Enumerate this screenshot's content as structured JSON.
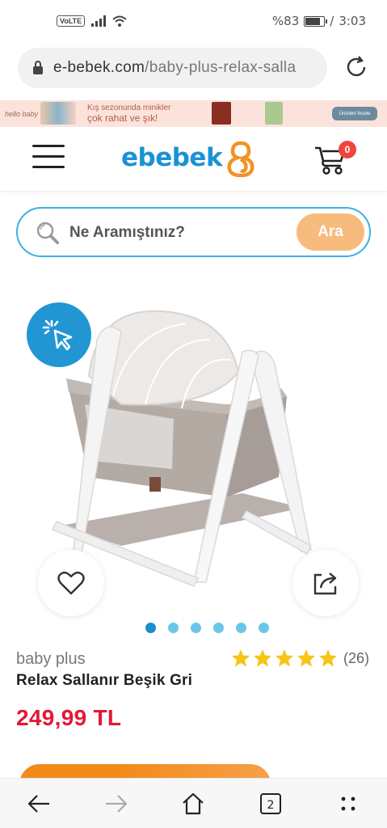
{
  "status_bar": {
    "network": "VoLTE",
    "battery_text": "%83",
    "battery_level": 0.83,
    "time": "3:03",
    "separator": "/"
  },
  "browser": {
    "url_domain": "e-bebek.com",
    "url_path": "/baby-plus-relax-salla",
    "tab_count": "2"
  },
  "promo": {
    "brand": "hello baby",
    "line1": "Kış sezonunda minikler",
    "line2": "çok rahat ve şık!",
    "button": "Ürünleri İncele"
  },
  "header": {
    "logo": "ebebek",
    "cart_count": "0"
  },
  "search": {
    "placeholder": "Ne Aramıştınız?",
    "button": "Ara"
  },
  "product": {
    "brand": "baby plus",
    "title": "Relax Sallanır Beşik Gri",
    "rating_stars": 5,
    "review_count": "(26)",
    "price": "249,99 TL",
    "image_count": 6,
    "active_image": 0
  },
  "colors": {
    "brand_blue": "#1a92d3",
    "search_border": "#3bb0e6",
    "search_button": "#f7bb7d",
    "price_red": "#e31837",
    "star_yellow": "#f5c518",
    "cta_orange": "#f28b1a",
    "cart_badge": "#f0443d"
  },
  "icons": {
    "lock": "lock-icon",
    "reload": "reload-icon",
    "menu": "hamburger-icon",
    "cart": "stroller-cart-icon",
    "search": "magnifier-icon",
    "zoom": "tap-cursor-icon",
    "favorite": "heart-icon",
    "share": "share-icon",
    "back": "arrow-left-icon",
    "forward": "arrow-right-icon",
    "home": "home-icon",
    "tabs": "tabs-icon",
    "more": "more-dots-icon"
  }
}
